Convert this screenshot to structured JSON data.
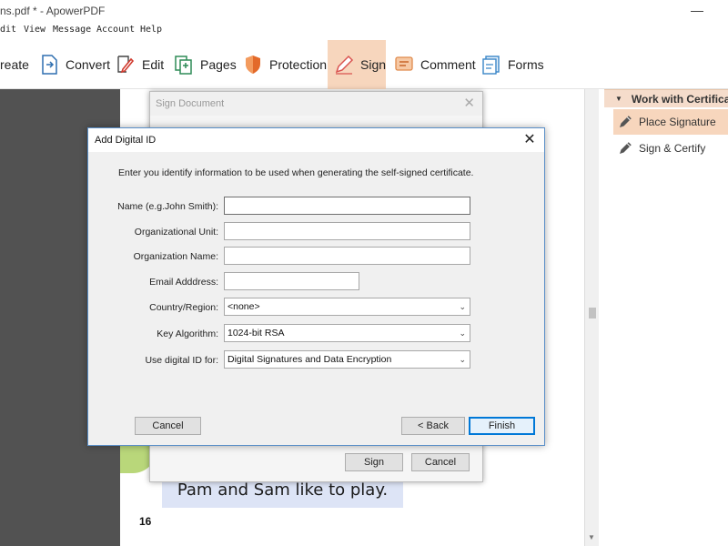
{
  "window": {
    "title": "ns.pdf * - ApowerPDF"
  },
  "menu": [
    "dit",
    "View",
    "Message",
    "Account",
    "Help"
  ],
  "toolbar": {
    "items": [
      {
        "label": "reate",
        "icon": "create-icon"
      },
      {
        "label": "Convert",
        "icon": "convert-icon"
      },
      {
        "label": "Edit",
        "icon": "edit-icon"
      },
      {
        "label": "Pages",
        "icon": "pages-icon"
      },
      {
        "label": "Protection",
        "icon": "shield-icon"
      },
      {
        "label": "Sign",
        "icon": "pen-icon",
        "active": true
      },
      {
        "label": "Comment",
        "icon": "comment-icon"
      },
      {
        "label": "Forms",
        "icon": "forms-icon"
      }
    ]
  },
  "document": {
    "story_text": "Pam and Sam like to play.",
    "page_number": "16"
  },
  "right_panel": {
    "header": "Work with Certificates",
    "items": [
      {
        "label": "Place Signature",
        "active": true
      },
      {
        "label": "Sign & Certify",
        "active": false
      }
    ]
  },
  "sign_dialog": {
    "title": "Sign Document",
    "sign_label": "Sign",
    "cancel_label": "Cancel"
  },
  "add_id_dialog": {
    "title": "Add Digital ID",
    "instruction": "Enter you identify information to be used when generating the self-signed certificate.",
    "fields": {
      "name_label": "Name (e.g.John Smith):",
      "org_unit_label": "Organizational Unit:",
      "org_name_label": "Organization Name:",
      "email_label": "Email Adddress:",
      "country_label": "Country/Region:",
      "country_value": "<none>",
      "key_label": "Key Algorithm:",
      "key_value": "1024-bit RSA",
      "use_label": "Use digital ID for:",
      "use_value": "Digital Signatures and Data Encryption"
    },
    "buttons": {
      "cancel": "Cancel",
      "back": "< Back",
      "finish": "Finish"
    }
  },
  "colors": {
    "accent": "#f7d6bd",
    "dialog_border": "#5a8fc8",
    "default_button": "#0078d7"
  }
}
